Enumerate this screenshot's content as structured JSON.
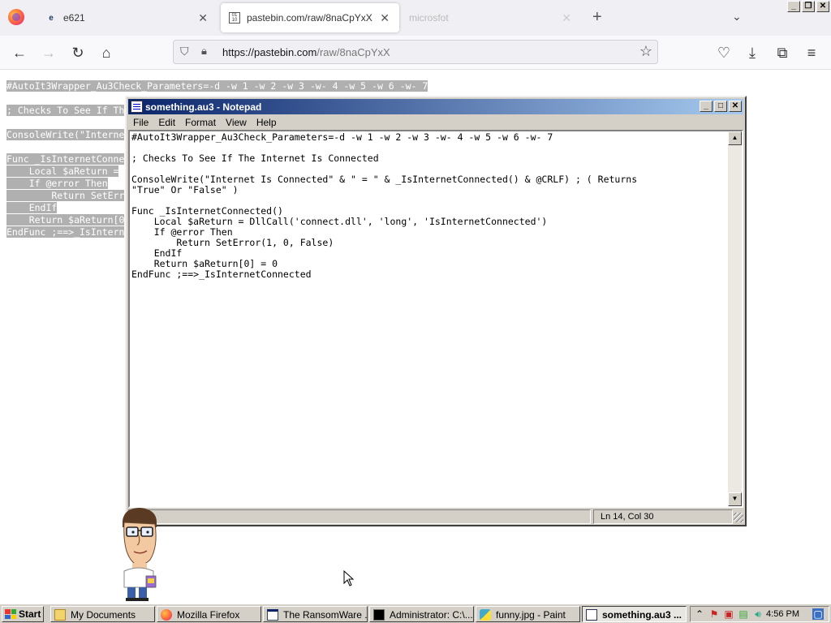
{
  "browser": {
    "tabs": [
      {
        "label": "e621",
        "favicon": "e621-icon",
        "state": "normal"
      },
      {
        "label": "pastebin.com/raw/8naCpYxX",
        "favicon": "raw-file-icon",
        "state": "active"
      },
      {
        "label": "microsfot",
        "favicon": "",
        "state": "dim"
      }
    ],
    "url_host": "https://pastebin.com",
    "url_path": "/raw/8naCpYxX"
  },
  "page": {
    "lines": [
      "#AutoIt3Wrapper_Au3Check_Parameters=-d -w 1 -w 2 -w 3 -w- 4 -w 5 -w 6 -w- 7",
      "; Checks To See If Th",
      "ConsoleWrite(\"Interne",
      "Func _IsInternetConne",
      "    Local $aReturn =",
      "    If @error Then",
      "        Return SetErr",
      "    EndIf",
      "    Return $aReturn[0",
      "EndFunc ;==>_IsIntern"
    ]
  },
  "notepad": {
    "title": "something.au3 - Notepad",
    "menu": [
      "File",
      "Edit",
      "Format",
      "View",
      "Help"
    ],
    "content": "#AutoIt3Wrapper_Au3Check_Parameters=-d -w 1 -w 2 -w 3 -w- 4 -w 5 -w 6 -w- 7\n\n; Checks To See If The Internet Is Connected\n\nConsoleWrite(\"Internet Is Connected\" & \" = \" & _IsInternetConnected() & @CRLF) ; ( Returns\n\"True\" Or \"False\" )\n\nFunc _IsInternetConnected()\n    Local $aReturn = DllCall('connect.dll', 'long', 'IsInternetConnected')\n    If @error Then\n        Return SetError(1, 0, False)\n    EndIf\n    Return $aReturn[0] = 0\nEndFunc ;==>_IsInternetConnected",
    "status_position": "Ln 14, Col 30"
  },
  "taskbar": {
    "start_label": "Start",
    "items": [
      {
        "label": "My Documents",
        "icon": "folder-icon",
        "active": false
      },
      {
        "label": "Mozilla Firefox",
        "icon": "firefox-icon",
        "active": false
      },
      {
        "label": "The RansomWare ...",
        "icon": "window-icon",
        "active": false
      },
      {
        "label": "Administrator: C:\\...",
        "icon": "cmd-icon",
        "active": false
      },
      {
        "label": "funny.jpg - Paint",
        "icon": "paint-icon",
        "active": false
      },
      {
        "label": "something.au3 ...",
        "icon": "notepad-icon",
        "active": true
      }
    ],
    "clock": "4:56 PM"
  },
  "colors": {
    "xp_face": "#d4d0c8",
    "title_start": "#0a246a",
    "title_end": "#a6caf0",
    "selection_gray": "#b0b0b0"
  }
}
